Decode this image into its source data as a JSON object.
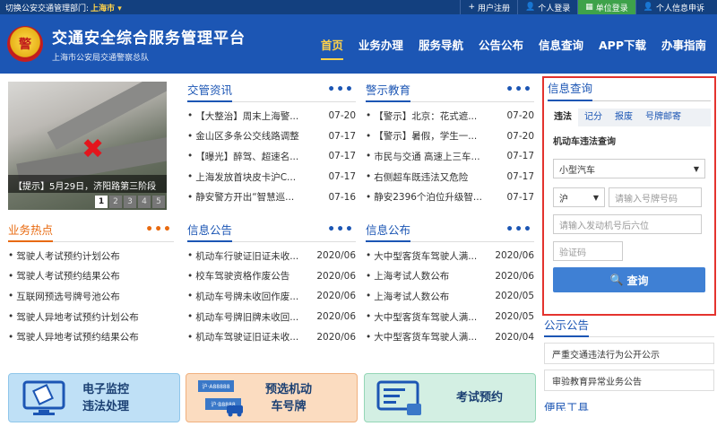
{
  "topbar": {
    "switch_text": "切换公安交通管理部门:",
    "city": "上海市",
    "links": [
      "用户注册",
      "个人登录",
      "单位登录",
      "个人信息申诉"
    ]
  },
  "header": {
    "logo_text": "警",
    "title": "交通安全综合服务管理平台",
    "subtitle": "上海市公安局交通警察总队",
    "nav": [
      "首页",
      "业务办理",
      "服务导航",
      "公告公布",
      "信息查询",
      "APP下载",
      "办事指南"
    ]
  },
  "slider": {
    "caption": "【提示】5月29日，济阳路第三阶段",
    "pages": [
      "1",
      "2",
      "3",
      "4",
      "5"
    ]
  },
  "news": {
    "title": "交管资讯",
    "items": [
      {
        "text": "【大整治】周末上海警...",
        "date": "07-20"
      },
      {
        "text": "金山区多条公交线路调整",
        "date": "07-17"
      },
      {
        "text": "【曝光】醉驾、超速名...",
        "date": "07-17"
      },
      {
        "text": "上海发放首块皮卡沪C...",
        "date": "07-17"
      },
      {
        "text": "静安警方开出“智慧巡...",
        "date": "07-16"
      }
    ]
  },
  "warn": {
    "title": "警示教育",
    "items": [
      {
        "text": "【警示】北京：花式遮...",
        "date": "07-20"
      },
      {
        "text": "【警示】暑假，学生一...",
        "date": "07-20"
      },
      {
        "text": "市民与交通 高速上三车...",
        "date": "07-17"
      },
      {
        "text": "右侧超车既违法又危险",
        "date": "07-17"
      },
      {
        "text": "静安2396个泊位升级智...",
        "date": "07-17"
      }
    ]
  },
  "hot": {
    "title": "业务热点",
    "items": [
      "驾驶人考试预约计划公布",
      "驾驶人考试预约结果公布",
      "互联网预选号牌号池公布",
      "驾驶人异地考试预约计划公布",
      "驾驶人异地考试预约结果公布"
    ]
  },
  "notice1": {
    "title": "信息公告",
    "items": [
      {
        "text": "机动车行驶证旧证未收...",
        "date": "2020/06"
      },
      {
        "text": "校车驾驶资格作废公告",
        "date": "2020/06"
      },
      {
        "text": "机动车号牌未收回作废...",
        "date": "2020/06"
      },
      {
        "text": "机动车号牌旧牌未收回...",
        "date": "2020/06"
      },
      {
        "text": "机动车驾驶证旧证未收...",
        "date": "2020/06"
      }
    ]
  },
  "notice2": {
    "title": "信息公布",
    "items": [
      {
        "text": "大中型客货车驾驶人满...",
        "date": "2020/06"
      },
      {
        "text": "上海考试人数公布",
        "date": "2020/06"
      },
      {
        "text": "上海考试人数公布",
        "date": "2020/05"
      },
      {
        "text": "大中型客货车驾驶人满...",
        "date": "2020/05"
      },
      {
        "text": "大中型客货车驾驶人满...",
        "date": "2020/04"
      }
    ]
  },
  "query": {
    "title": "信息查询",
    "tabs": [
      "违法",
      "记分",
      "报废",
      "号牌邮寄"
    ],
    "label": "机动车违法查询",
    "vehicle_type": "小型汽车",
    "prefix": "沪",
    "plate_placeholder": "请输入号牌号码",
    "engine_placeholder": "请输入发动机号后六位",
    "captcha_placeholder": "验证码",
    "button": "查询"
  },
  "public_notice": {
    "title": "公示公告",
    "items": [
      "严重交通违法行为公开公示",
      "审验教育异常业务公告"
    ],
    "next_title": "便民工具"
  },
  "actions": {
    "monitor_line1": "电子监控",
    "monitor_line2": "违法处理",
    "plate_line1": "预选机动",
    "plate_line2": "车号牌",
    "exam": "考试预约",
    "plate_demo_top": "沪·A88888",
    "plate_demo_bottom": "沪·B8888"
  },
  "colors": {
    "brand": "#1c56b4",
    "accent": "#e86a10",
    "highlight": "#e4332e",
    "green": "#3ea24a"
  }
}
